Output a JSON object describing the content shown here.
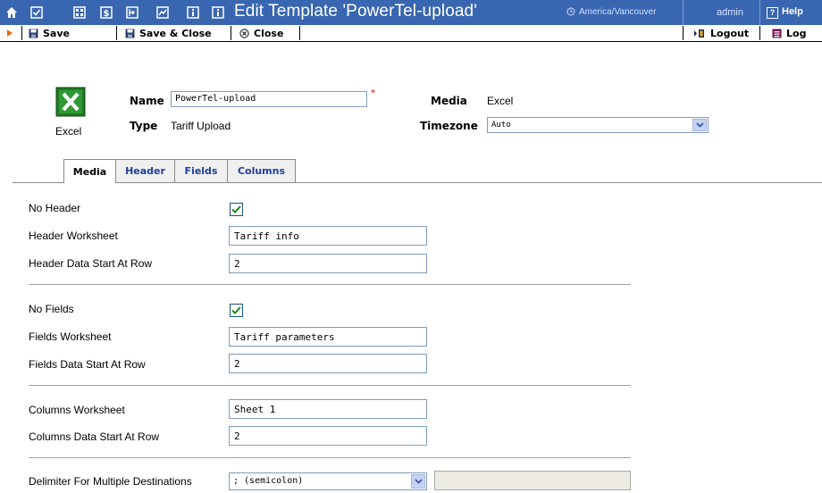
{
  "header": {
    "title": "Edit Template 'PowerTel-upload'",
    "timezone": "America/Vancouver",
    "user": "admin",
    "help": "Help"
  },
  "toolbar": {
    "save": "Save",
    "save_close": "Save & Close",
    "close": "Close",
    "logout": "Logout",
    "log": "Log"
  },
  "template": {
    "media_icon_label": "Excel",
    "name_label": "Name",
    "name_value": "PowerTel-upload",
    "type_label": "Type",
    "type_value": "Tariff Upload",
    "media_label": "Media",
    "media_value": "Excel",
    "timezone_label": "Timezone",
    "timezone_value": "Auto"
  },
  "tabs": [
    "Media",
    "Header",
    "Fields",
    "Columns"
  ],
  "form": {
    "no_header": {
      "label": "No Header",
      "checked": true
    },
    "header_worksheet": {
      "label": "Header Worksheet",
      "value": "Tariff info"
    },
    "header_start_row": {
      "label": "Header Data Start At Row",
      "value": "2"
    },
    "no_fields": {
      "label": "No Fields",
      "checked": true
    },
    "fields_worksheet": {
      "label": "Fields Worksheet",
      "value": "Tariff parameters"
    },
    "fields_start_row": {
      "label": "Fields Data Start At Row",
      "value": "2"
    },
    "columns_worksheet": {
      "label": "Columns Worksheet",
      "value": "Sheet 1"
    },
    "columns_start_row": {
      "label": "Columns Data Start At Row",
      "value": "2"
    },
    "delimiter": {
      "label": "Delimiter For Multiple Destinations",
      "value": "; (semicolon)"
    }
  },
  "colors": {
    "titlebar": "#3966b0",
    "tab_text": "#1e3f9a",
    "checkmark": "#1d8a1d"
  }
}
